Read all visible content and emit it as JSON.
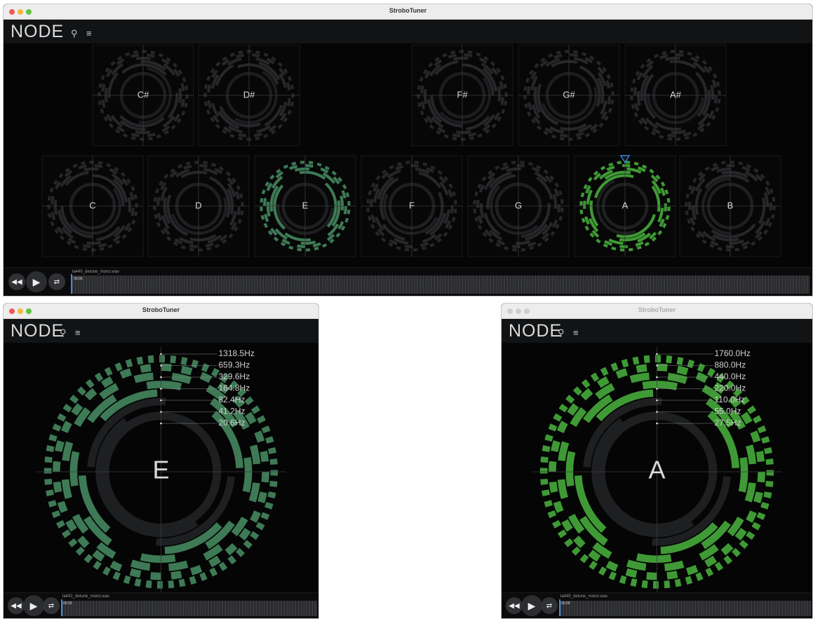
{
  "top_window": {
    "title": "StroboTuner",
    "logo": "NODE",
    "icons": [
      "sliders-icon",
      "list-icon"
    ],
    "sharps": [
      "C#",
      "D#",
      "F#",
      "G#",
      "A#"
    ],
    "naturals": [
      "C",
      "D",
      "E",
      "F",
      "G",
      "A",
      "B"
    ],
    "file_name": "la440_detune_mono.wav",
    "time": "00:00"
  },
  "left_window": {
    "title": "StroboTuner",
    "logo": "NODE",
    "note": "E",
    "frequencies": [
      "1318.5Hz",
      "659.3Hz",
      "329.6Hz",
      "164.8Hz",
      "82.4Hz",
      "41.2Hz",
      "20.6Hz"
    ],
    "file_name": "la441_detune_mono.wav",
    "time": "00:00"
  },
  "right_window": {
    "title": "StroboTuner",
    "logo": "NODE",
    "note": "A",
    "frequencies": [
      "1760.0Hz",
      "880.0Hz",
      "440.0Hz",
      "220.0Hz",
      "110.0Hz",
      "55.0Hz",
      "27.5Hz"
    ],
    "file_name": "la440_detune_mono.wav",
    "time": "00:00"
  },
  "colors": {
    "inactive": "#2a2b2d",
    "e_active": "#3e7a55",
    "a_active": "#3f9a35",
    "accent": "#3d8be0"
  }
}
